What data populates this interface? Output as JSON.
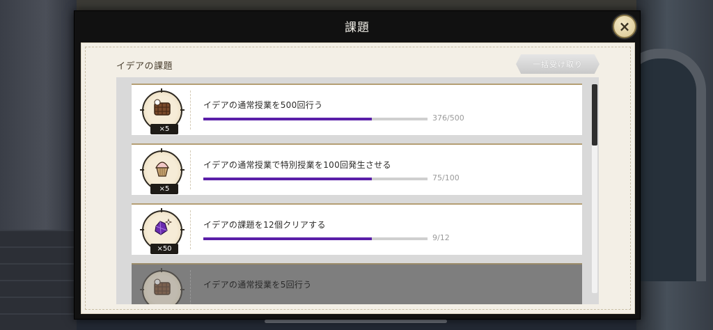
{
  "modal": {
    "title": "課題",
    "close_label": "×"
  },
  "section": {
    "title": "イデアの課題",
    "claim_all_label": "一括受け取り"
  },
  "colors": {
    "progress_fill": "#5a1fa8",
    "accent_border": "#b49e73"
  },
  "tasks": [
    {
      "label": "イデアの通常授業を500回行う",
      "progress_text": "376/500",
      "progress": 0.752,
      "reward_icon": "waffle-icon",
      "reward_count": "×5"
    },
    {
      "label": "イデアの通常授業で特別授業を100回発生させる",
      "progress_text": "75/100",
      "progress": 0.75,
      "reward_icon": "cupcake-icon",
      "reward_count": "×5"
    },
    {
      "label": "イデアの課題を12個クリアする",
      "progress_text": "9/12",
      "progress": 0.75,
      "reward_icon": "gem-icon",
      "reward_count": "×50"
    },
    {
      "label": "イデアの通常授業を5回行う",
      "status": "claimed",
      "reward_icon": "waffle-icon"
    }
  ]
}
